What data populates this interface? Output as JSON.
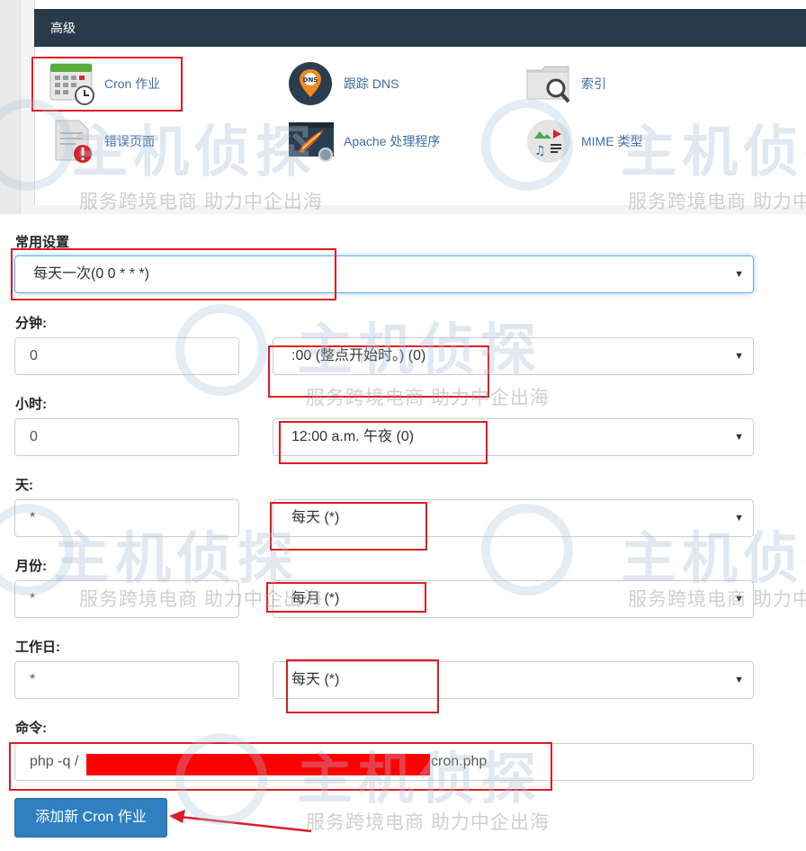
{
  "advanced": {
    "header": "高级",
    "items": [
      {
        "label": "Cron 作业",
        "icon": "calendar-clock-icon"
      },
      {
        "label": "跟踪 DNS",
        "icon": "dns-pin-icon"
      },
      {
        "label": "索引",
        "icon": "folder-search-icon"
      },
      {
        "label": "错误页面",
        "icon": "error-page-icon"
      },
      {
        "label": "Apache 处理程序",
        "icon": "apache-handler-icon"
      },
      {
        "label": "MIME 类型",
        "icon": "mime-types-icon"
      }
    ]
  },
  "form": {
    "common_label": "常用设置",
    "common_value": "每天一次(0 0 * * *)",
    "minute_label": "分钟:",
    "minute_value": "0",
    "minute_select": ":00 (整点开始时。) (0)",
    "hour_label": "小时:",
    "hour_value": "0",
    "hour_select": "12:00 a.m. 午夜 (0)",
    "day_label": "天:",
    "day_value": "*",
    "day_select": "每天 (*)",
    "month_label": "月份:",
    "month_value": "*",
    "month_select": "每月 (*)",
    "weekday_label": "工作日:",
    "weekday_value": "*",
    "weekday_select": "每天 (*)",
    "command_label": "命令:",
    "command_prefix": "php -q /",
    "command_suffix": "cron.php",
    "submit_label": "添加新 Cron 作业"
  },
  "watermark": {
    "brand": "主机侦探",
    "slogan": "服务跨境电商 助力中企出海"
  },
  "colors": {
    "header_bg": "#293a4a",
    "link": "#3d6ea8",
    "button": "#2f7fc1",
    "annotation_red": "#e01b22"
  }
}
